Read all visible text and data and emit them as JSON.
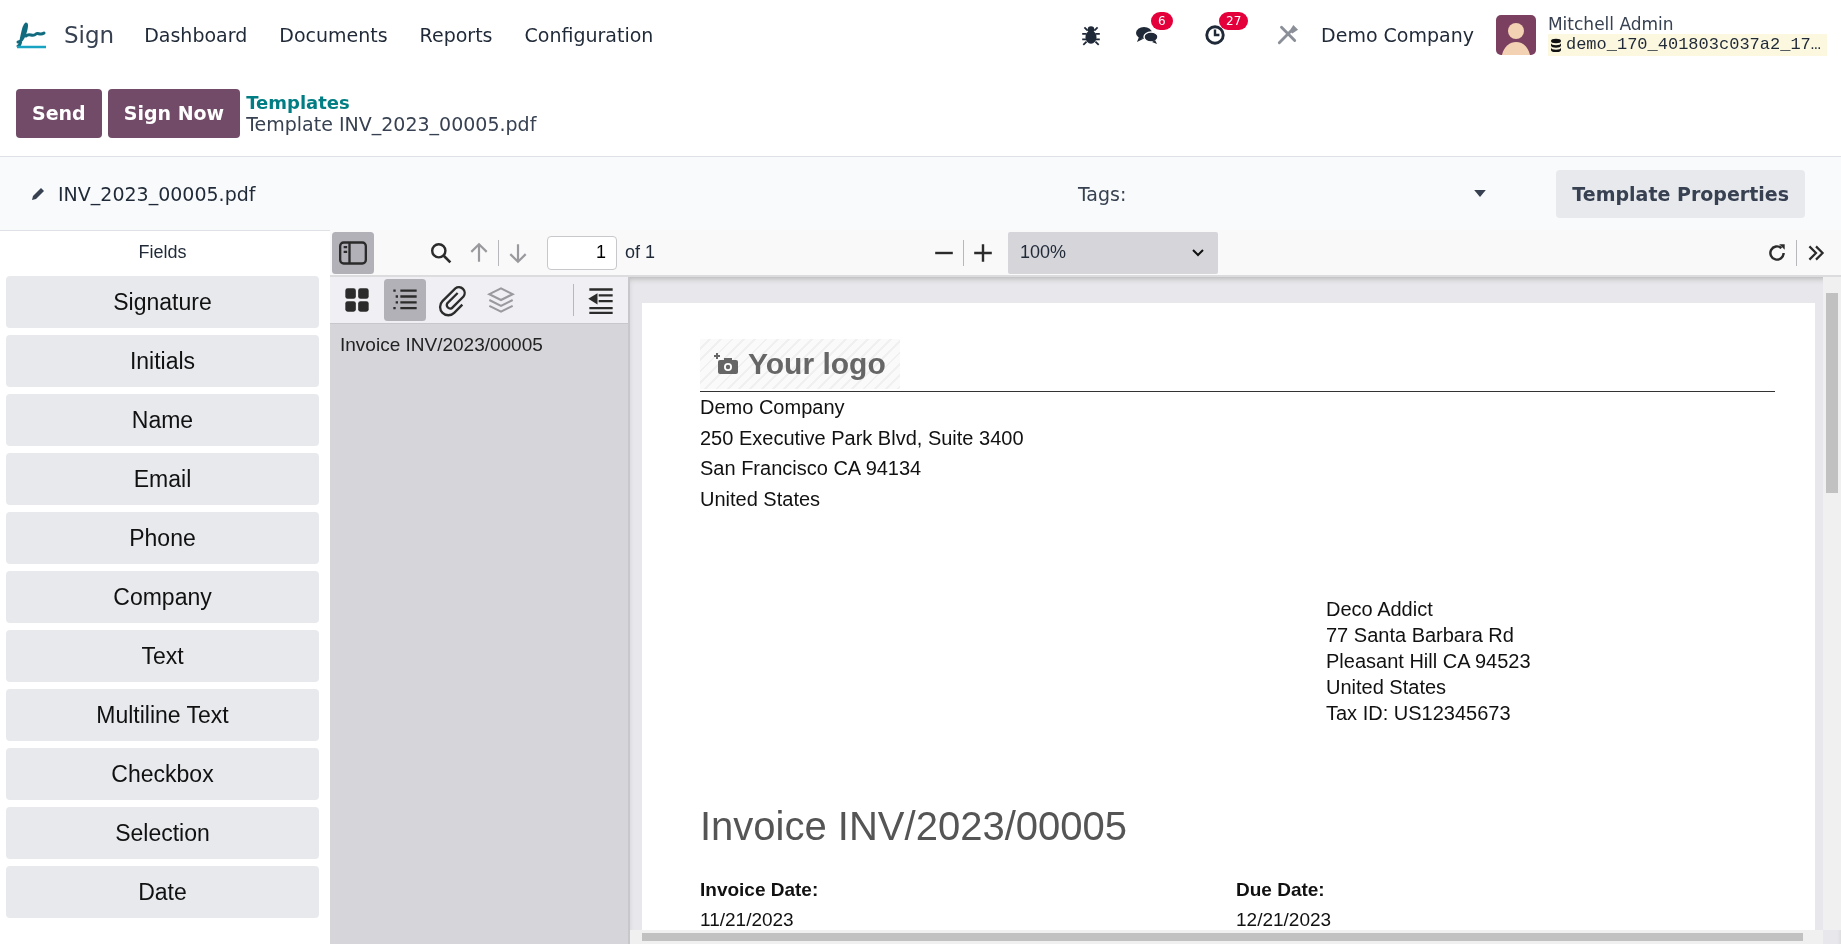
{
  "app": {
    "name": "Sign"
  },
  "menu": [
    {
      "label": "Dashboard"
    },
    {
      "label": "Documents"
    },
    {
      "label": "Reports"
    },
    {
      "label": "Configuration"
    }
  ],
  "systray": {
    "messages_count": "6",
    "activities_count": "27",
    "company": "Demo Company",
    "user": "Mitchell Admin",
    "database": "demo_170_401803c037a2_17…"
  },
  "actions": [
    "Send",
    "Sign Now"
  ],
  "breadcrumb": {
    "parent": "Templates",
    "current": "Template INV_2023_00005.pdf"
  },
  "document": {
    "filename": "INV_2023_00005.pdf",
    "tags_label": "Tags:",
    "properties_button": "Template Properties"
  },
  "fields_panel": {
    "title": "Fields",
    "items": [
      "Signature",
      "Initials",
      "Name",
      "Email",
      "Phone",
      "Company",
      "Text",
      "Multiline Text",
      "Checkbox",
      "Selection",
      "Date"
    ]
  },
  "viewer": {
    "sidebar_open": true,
    "page": "1",
    "page_count": "of 1",
    "zoom": "100%",
    "sidebar_views": [
      {
        "kind": "thumbnails",
        "selected": false,
        "disabled": false
      },
      {
        "kind": "outline",
        "selected": true,
        "disabled": false
      },
      {
        "kind": "attachments",
        "selected": false,
        "disabled": false
      },
      {
        "kind": "layers",
        "selected": false,
        "disabled": true
      }
    ],
    "outline": [
      {
        "label": "Invoice INV/2023/00005"
      }
    ]
  },
  "page": {
    "logo": "Your logo",
    "company_address": [
      "Demo Company",
      "250 Executive Park Blvd, Suite 3400",
      "San Francisco CA 94134",
      "United States"
    ],
    "customer_address": [
      "Deco Addict",
      "77 Santa Barbara Rd",
      "Pleasant Hill CA 94523",
      "United States",
      "Tax ID: US12345673"
    ],
    "title": "Invoice INV/2023/00005",
    "info": [
      {
        "label": "Invoice Date:",
        "value": "11/21/2023"
      },
      {
        "label": "Due Date:",
        "value": "12/21/2023"
      }
    ]
  }
}
